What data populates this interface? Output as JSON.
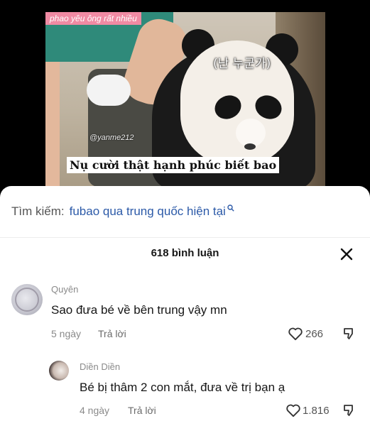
{
  "video": {
    "top_caption": "phao yêu ông rất nhiều",
    "korean_caption": "(난 누군가)",
    "watermark": "@yanme212",
    "subtitle": "Nụ cười thật hạnh phúc biết bao"
  },
  "search": {
    "label": "Tìm kiếm:",
    "query": "fubao qua trung quốc hiện tại",
    "icon": "search-icon",
    "query_color": "#2c5aa8"
  },
  "comments_header": {
    "count_label": "618 bình luận",
    "close_icon": "close-icon"
  },
  "comments": [
    {
      "author": "Quyên",
      "text": "Sao đưa bé về bên trung vậy mn",
      "time": "5 ngày",
      "reply_label": "Trả lời",
      "likes": "266"
    },
    {
      "author": "Diền Diền",
      "text": "Bé bị thâm 2 con mắt, đưa về trị bạn ạ",
      "time": "4 ngày",
      "reply_label": "Trả lời",
      "likes": "1.816"
    }
  ]
}
